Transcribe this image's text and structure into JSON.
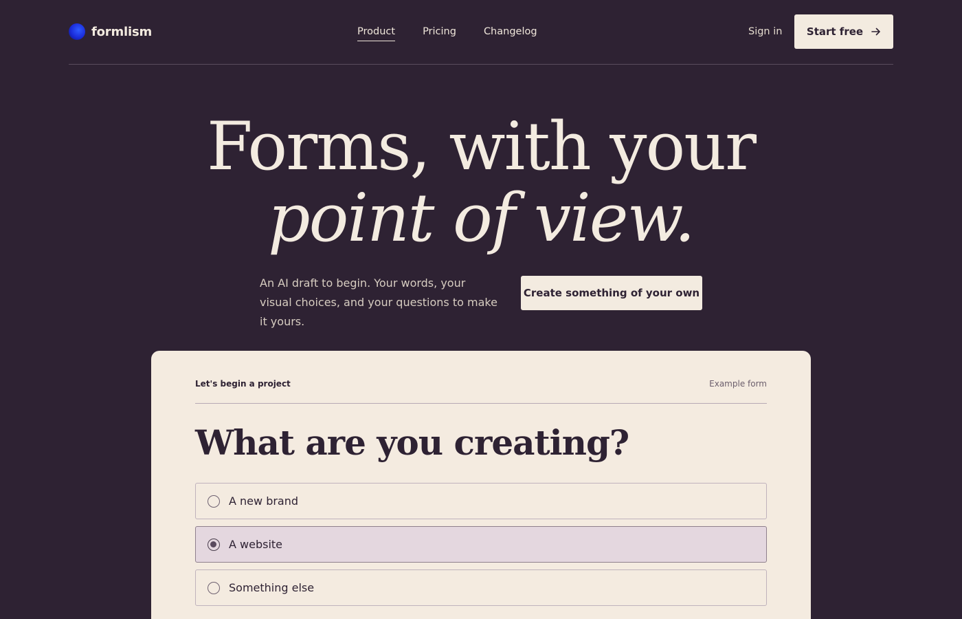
{
  "nav": {
    "brand": "formlism",
    "links": [
      {
        "label": "Product",
        "active": true
      },
      {
        "label": "Pricing",
        "active": false
      },
      {
        "label": "Changelog",
        "active": false
      }
    ],
    "sign_in": "Sign in",
    "start_free": "Start free",
    "start_free_icon": "arrow-right-icon"
  },
  "hero": {
    "line1": "Forms, with your",
    "line2": "point of view.",
    "subtitle": "An AI draft to begin. Your words, your visual choices, and your questions to make it yours.",
    "cta": "Create something of your own"
  },
  "form": {
    "kicker": "Let's begin a project",
    "tag": "Example form",
    "question": "What are you creating?",
    "options": [
      {
        "label": "A new brand",
        "selected": false
      },
      {
        "label": "A website",
        "selected": true
      },
      {
        "label": "Something else",
        "selected": false
      }
    ]
  },
  "colors": {
    "background": "#2e2233",
    "cream": "#f3ebe0",
    "selected_option": "#e4d7df",
    "brand_dot": "#1a2bd9"
  }
}
